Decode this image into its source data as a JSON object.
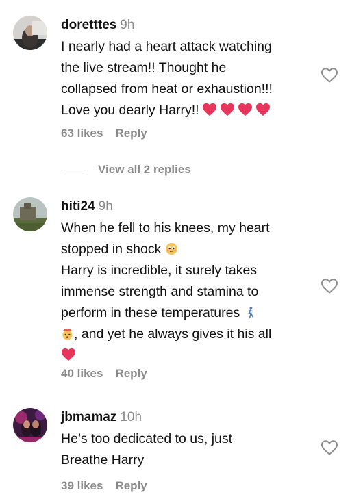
{
  "comments": [
    {
      "username": "doretttes",
      "time": "9h",
      "lines": [
        "I nearly had a heart attack watching",
        "the live stream!! Thought he",
        "collapsed from heat or exhaustion!!!",
        "Love you dearly Harry!!"
      ],
      "likes": "63 likes",
      "reply": "Reply",
      "view_replies": "View all 2 replies"
    },
    {
      "username": "hiti24",
      "time": "9h",
      "lines": [
        "When he fell to his knees, my heart",
        "stopped in shock",
        "Harry is incredible, it surely takes",
        "immense strength and stamina to",
        "perform in these temperatures",
        ", and yet he always gives it his all"
      ],
      "likes": "40 likes",
      "reply": "Reply"
    },
    {
      "username": "jbmamaz",
      "time": "10h",
      "lines": [
        "He’s too dedicated to us, just",
        "Breathe Harry"
      ],
      "likes": "39 likes",
      "reply": "Reply"
    }
  ],
  "icons": {
    "heart_outline": "heart-outline-icon",
    "heart_emoji": "red-heart-emoji",
    "heart_emoji_color": "#e8355c",
    "like_outline_color": "#8e8e8e"
  }
}
